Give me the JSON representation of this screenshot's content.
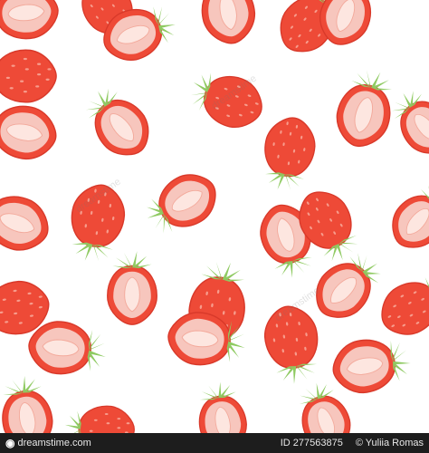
{
  "watermark": {
    "text": "dreamstime"
  },
  "footer": {
    "brand": "dreamstime.com",
    "id_text": "ID 277563875",
    "credit": "© Yuliia Romas"
  },
  "colors": {
    "background": "#ffffff",
    "strawberry_red": "#ee4a37",
    "strawberry_outline": "#c72f22",
    "flesh_pink": "#f7c6bd",
    "core_light": "#fde6e0",
    "leaf_green": "#8fca62",
    "leaf_dark": "#6aa845",
    "seed": "#f6a192",
    "footer_bg": "#1d1d1d"
  },
  "icons": {
    "brand_logo": "dreamstime-logo-icon",
    "whole_strawberry": "whole-strawberry-icon",
    "half_strawberry": "half-strawberry-icon"
  }
}
